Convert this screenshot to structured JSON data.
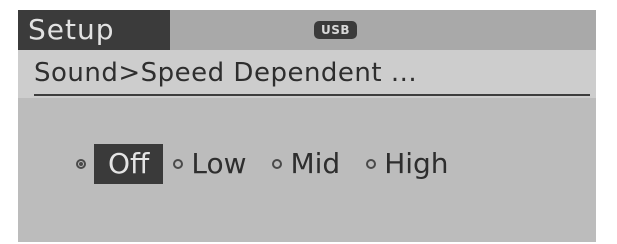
{
  "header": {
    "tab_title": "Setup",
    "source_badge": "USB"
  },
  "breadcrumb": "Sound>Speed Dependent ...",
  "setting": {
    "options": [
      {
        "label": "Off",
        "selected": true
      },
      {
        "label": "Low",
        "selected": false
      },
      {
        "label": "Mid",
        "selected": false
      },
      {
        "label": "High",
        "selected": false
      }
    ]
  }
}
